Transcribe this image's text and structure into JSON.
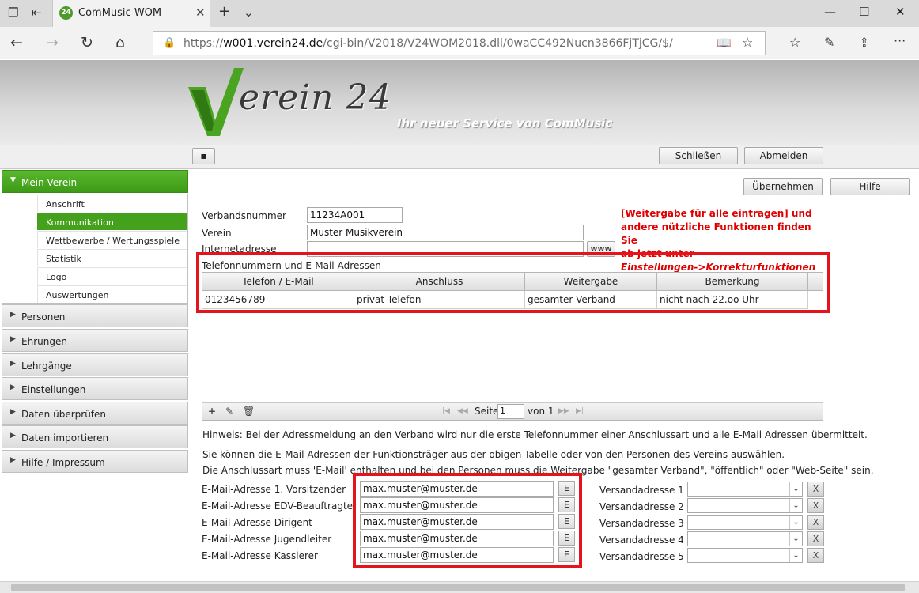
{
  "browser": {
    "tab_title": "ComMusic WOM",
    "favicon_text": "24",
    "url_host": "w001.verein24.de",
    "url_prefix": "https://",
    "url_path": "/cgi-bin/V2018/V24WOM2018.dll/0waCC492Nucn3866FjTjCG/$/"
  },
  "header": {
    "logo_text": "erein 24",
    "slogan": "Ihr neuer Service von ComMusic",
    "close_label": "Schließen",
    "logout_label": "Abmelden"
  },
  "sidebar": {
    "sections": [
      {
        "label": "Mein Verein"
      },
      {
        "label": "Personen"
      },
      {
        "label": "Ehrungen"
      },
      {
        "label": "Lehrgänge"
      },
      {
        "label": "Einstellungen"
      },
      {
        "label": "Daten überprüfen"
      },
      {
        "label": "Daten importieren"
      },
      {
        "label": "Hilfe / Impressum"
      }
    ],
    "sub_items": [
      {
        "label": "Anschrift"
      },
      {
        "label": "Kommunikation"
      },
      {
        "label": "Wettbewerbe / Wertungsspiele"
      },
      {
        "label": "Statistik"
      },
      {
        "label": "Logo"
      },
      {
        "label": "Auswertungen"
      }
    ]
  },
  "main": {
    "apply_label": "Übernehmen",
    "help_label": "Hilfe",
    "verbandsnummer_label": "Verbandsnummer",
    "verbandsnummer_value": "11234A001",
    "verein_label": "Verein",
    "verein_value": "Muster Musikverein",
    "internet_label": "Internetadresse",
    "internet_value": "",
    "www_label": "www",
    "note_line1": "[Weitergabe für alle eintragen] und",
    "note_line2": "andere nützliche Funktionen finden Sie",
    "note_line3": "ab jetzt unter",
    "note_line4": "Einstellungen->Korrekturfunktionen",
    "phone_section_title": "Telefonnummern und E-Mail-Adressen",
    "grid": {
      "columns": [
        "Telefon / E-Mail",
        "Anschluss",
        "Weitergabe",
        "Bemerkung"
      ],
      "rows": [
        [
          "0123456789",
          "privat Telefon",
          "gesamter Verband",
          "nicht nach 22.oo Uhr"
        ]
      ]
    },
    "pager": {
      "page_label": "Seite",
      "page_value": "1",
      "of_label": "von 1"
    },
    "hint1": "Hinweis: Bei der Adressmeldung an den Verband wird nur die erste Telefonnummer einer Anschlussart und alle E-Mail Adressen übermittelt.",
    "hint2": "Sie können die E-Mail-Adressen der Funktionsträger aus der obigen Tabelle oder von den Personen des Vereins auswählen.",
    "hint3": "Die Anschlussart muss 'E-Mail' enthalten und bei den Personen muss die Weitergabe \"gesamter Verband\", \"öffentlich\" oder \"Web-Seite\" sein.",
    "email_rows": [
      {
        "label": "E-Mail-Adresse 1. Vorsitzender",
        "value": "max.muster@muster.de",
        "e": "E",
        "versand_label": "Versandadresse 1",
        "x": "X"
      },
      {
        "label": "E-Mail-Adresse EDV-Beauftragter",
        "value": "max.muster@muster.de",
        "e": "E",
        "versand_label": "Versandadresse 2",
        "x": "X"
      },
      {
        "label": "E-Mail-Adresse Dirigent",
        "value": "max.muster@muster.de",
        "e": "E",
        "versand_label": "Versandadresse 3",
        "x": "X"
      },
      {
        "label": "E-Mail-Adresse Jugendleiter",
        "value": "max.muster@muster.de",
        "e": "E",
        "versand_label": "Versandadresse 4",
        "x": "X"
      },
      {
        "label": "E-Mail-Adresse Kassierer",
        "value": "max.muster@muster.de",
        "e": "E",
        "versand_label": "Versandadresse 5",
        "x": "X"
      }
    ]
  },
  "colors": {
    "accent_green": "#44a11c",
    "highlight_red": "#e5131c",
    "note_red": "#e00000"
  }
}
